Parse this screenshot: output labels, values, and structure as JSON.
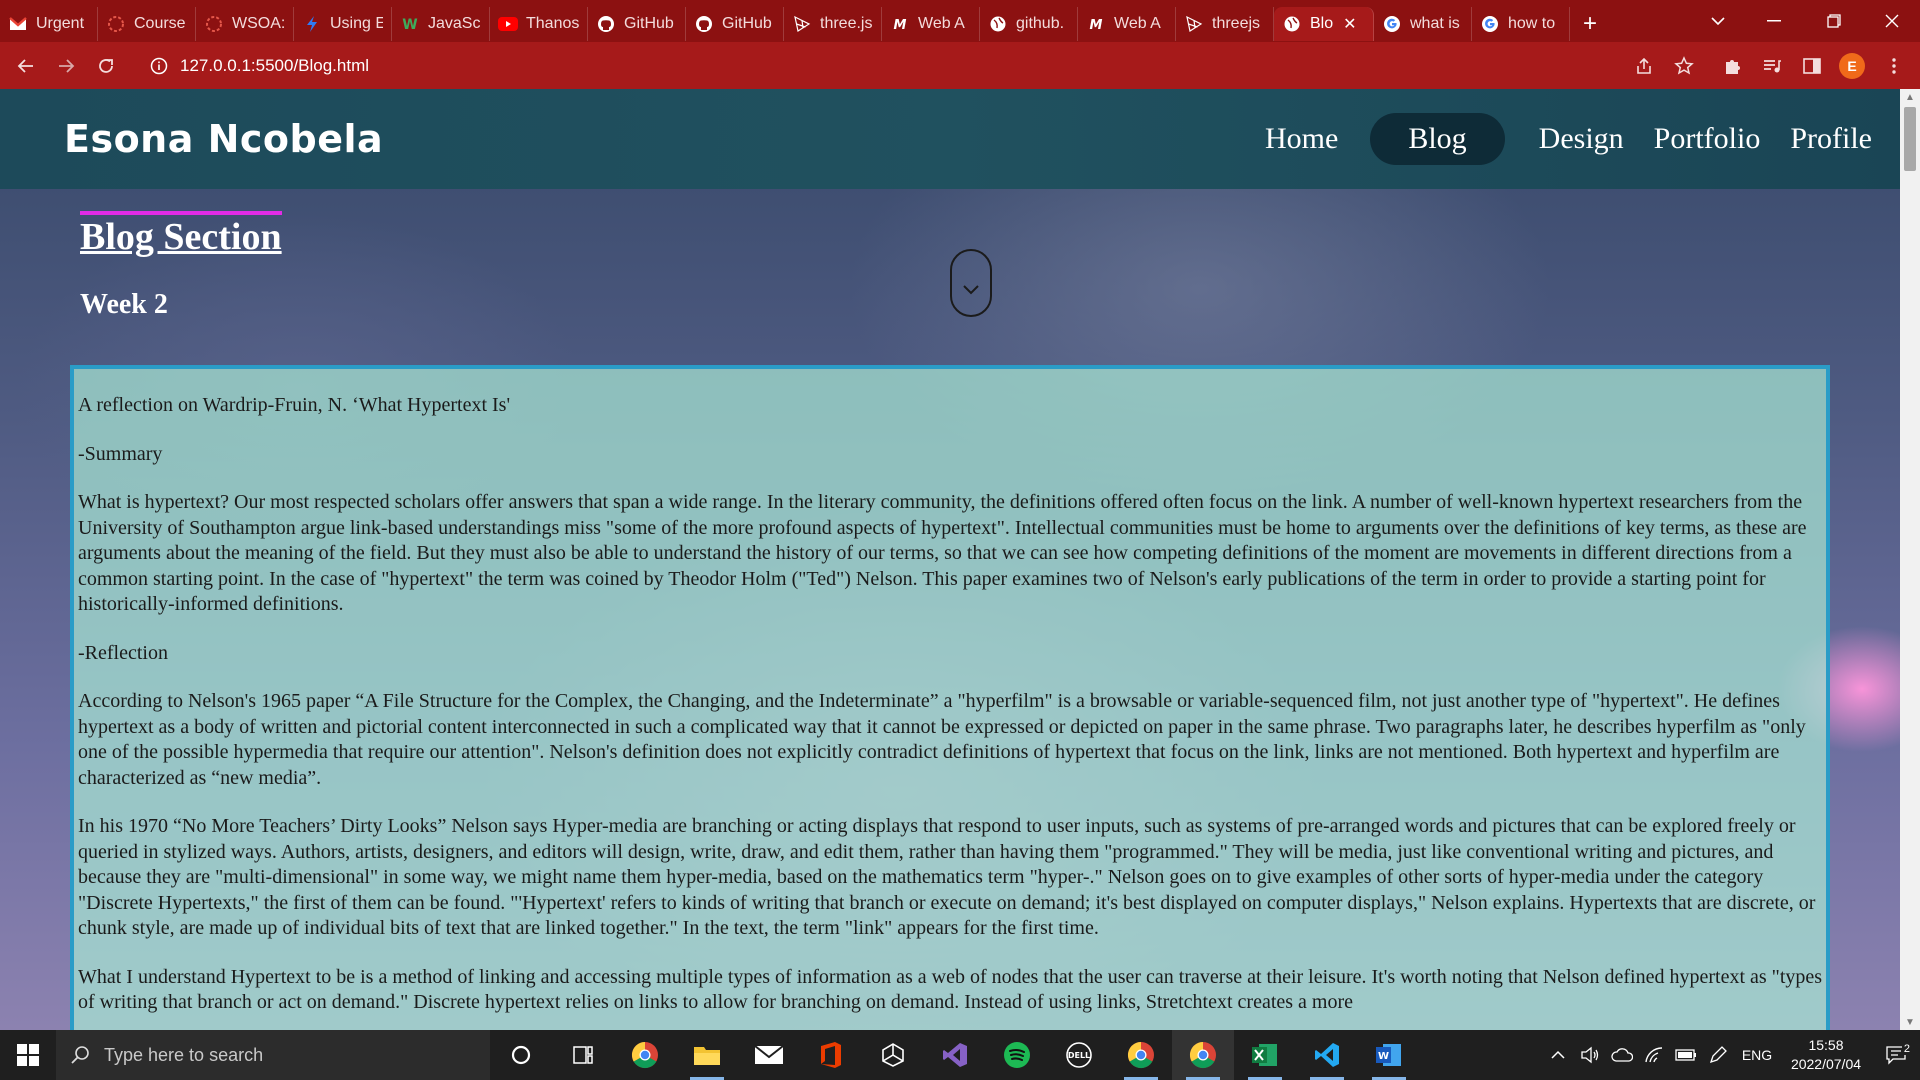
{
  "browser": {
    "tabs": [
      {
        "label": "Urgent",
        "icon": "gmail-icon",
        "color": "#ea4335"
      },
      {
        "label": "Course",
        "icon": "course-icon",
        "color": "#e4574a"
      },
      {
        "label": "WSOA:",
        "icon": "course-icon",
        "color": "#e4574a"
      },
      {
        "label": "Using E",
        "icon": "bolt-icon",
        "color": "#2f7bf5"
      },
      {
        "label": "JavaScr",
        "icon": "w3schools-icon",
        "color": "#3eab5c"
      },
      {
        "label": "Thanos",
        "icon": "youtube-icon",
        "color": "#ff0000"
      },
      {
        "label": "GitHub",
        "icon": "github-icon",
        "color": "#ffffff"
      },
      {
        "label": "GitHub",
        "icon": "github-icon",
        "color": "#ffffff"
      },
      {
        "label": "three.js",
        "icon": "threejs-icon",
        "color": "#ffffff"
      },
      {
        "label": "Web A",
        "icon": "mdn-icon",
        "color": "#ffffff"
      },
      {
        "label": "github.",
        "icon": "globe-icon",
        "color": "#ffffff"
      },
      {
        "label": "Web A",
        "icon": "mdn-icon",
        "color": "#ffffff"
      },
      {
        "label": "threejs",
        "icon": "threejs-icon",
        "color": "#ffffff"
      },
      {
        "label": "Blo",
        "icon": "globe-icon",
        "color": "#ffffff",
        "active": true
      },
      {
        "label": "what is",
        "icon": "google-icon",
        "color": "#ffffff"
      },
      {
        "label": "how to",
        "icon": "google-icon",
        "color": "#ffffff"
      }
    ],
    "url": "127.0.0.1:5500/Blog.html",
    "profile_initial": "E"
  },
  "site": {
    "brand": "Esona Ncobela",
    "nav": [
      "Home",
      "Blog",
      "Design",
      "Portfolio",
      "Profile"
    ],
    "active_nav": "Blog",
    "section_title": "Blog Section",
    "week": "Week 2"
  },
  "article": {
    "paragraphs": [
      "A reflection on Wardrip-Fruin, N. ‘What Hypertext Is'",
      "-Summary",
      "What is hypertext? Our most respected scholars offer answers that span a wide range. In the literary community, the definitions offered often focus on the link. A number of well-known hypertext researchers from the University of Southampton argue link-based understandings miss \"some of the more profound aspects of hypertext\". Intellectual communities must be home to arguments over the definitions of key terms, as these are arguments about the meaning of the field. But they must also be able to understand the history of our terms, so that we can see how competing definitions of the moment are movements in different directions from a common starting point. In the case of \"hypertext\" the term was coined by Theodor Holm (\"Ted\") Nelson. This paper examines two of Nelson's early publications of the term in order to provide a starting point for historically-informed definitions.",
      "-Reflection",
      "According to Nelson's 1965 paper “A File Structure for the Complex, the Changing, and the Indeterminate” a \"hyperfilm\" is a browsable or variable-sequenced film, not just another type of \"hypertext\". He defines hypertext as a body of written and pictorial content interconnected in such a complicated way that it cannot be expressed or depicted on paper in the same phrase. Two paragraphs later, he describes hyperfilm as \"only one of the possible hypermedia that require our attention\". Nelson's definition does not explicitly contradict definitions of hypertext that focus on the link, links are not mentioned. Both hypertext and hyperfilm are characterized as “new media”.",
      "In his 1970 “No More Teachers’ Dirty Looks” Nelson says Hyper-media are branching or acting displays that respond to user inputs, such as systems of pre-arranged words and pictures that can be explored freely or queried in stylized ways. Authors, artists, designers, and editors will design, write, draw, and edit them, rather than having them \"programmed.\" They will be media, just like conventional writing and pictures, and because they are \"multi-dimensional\" in some way, we might name them hyper-media, based on the mathematics term \"hyper-.\" Nelson goes on to give examples of other sorts of hyper-media under the category \"Discrete Hypertexts,\" the first of them can be found. \"'Hypertext' refers to kinds of writing that branch or execute on demand; it's best displayed on computer displays,\" Nelson explains. Hypertexts that are discrete, or chunk style, are made up of individual bits of text that are linked together.\" In the text, the term \"link\" appears for the first time.",
      "What I understand Hypertext to be is a method of linking and accessing multiple types of information as a web of nodes that the user can traverse at their leisure. It's worth noting that Nelson defined hypertext as \"types of writing that branch or act on demand.\" Discrete hypertext relies on links to allow for branching on demand. Instead of using links, Stretchtext creates a more"
    ]
  },
  "taskbar": {
    "search_placeholder": "Type here to search",
    "time": "15:58",
    "date": "2022/07/04",
    "lang": "ENG",
    "notifications": "2"
  },
  "colors": {
    "tabstrip": "#8c1111",
    "toolbar": "#a61a1a",
    "header": "#1d4a5a",
    "nav_active": "#0e2b37",
    "title_rule": "#e22be6",
    "article_border": "#2a9cc7"
  }
}
